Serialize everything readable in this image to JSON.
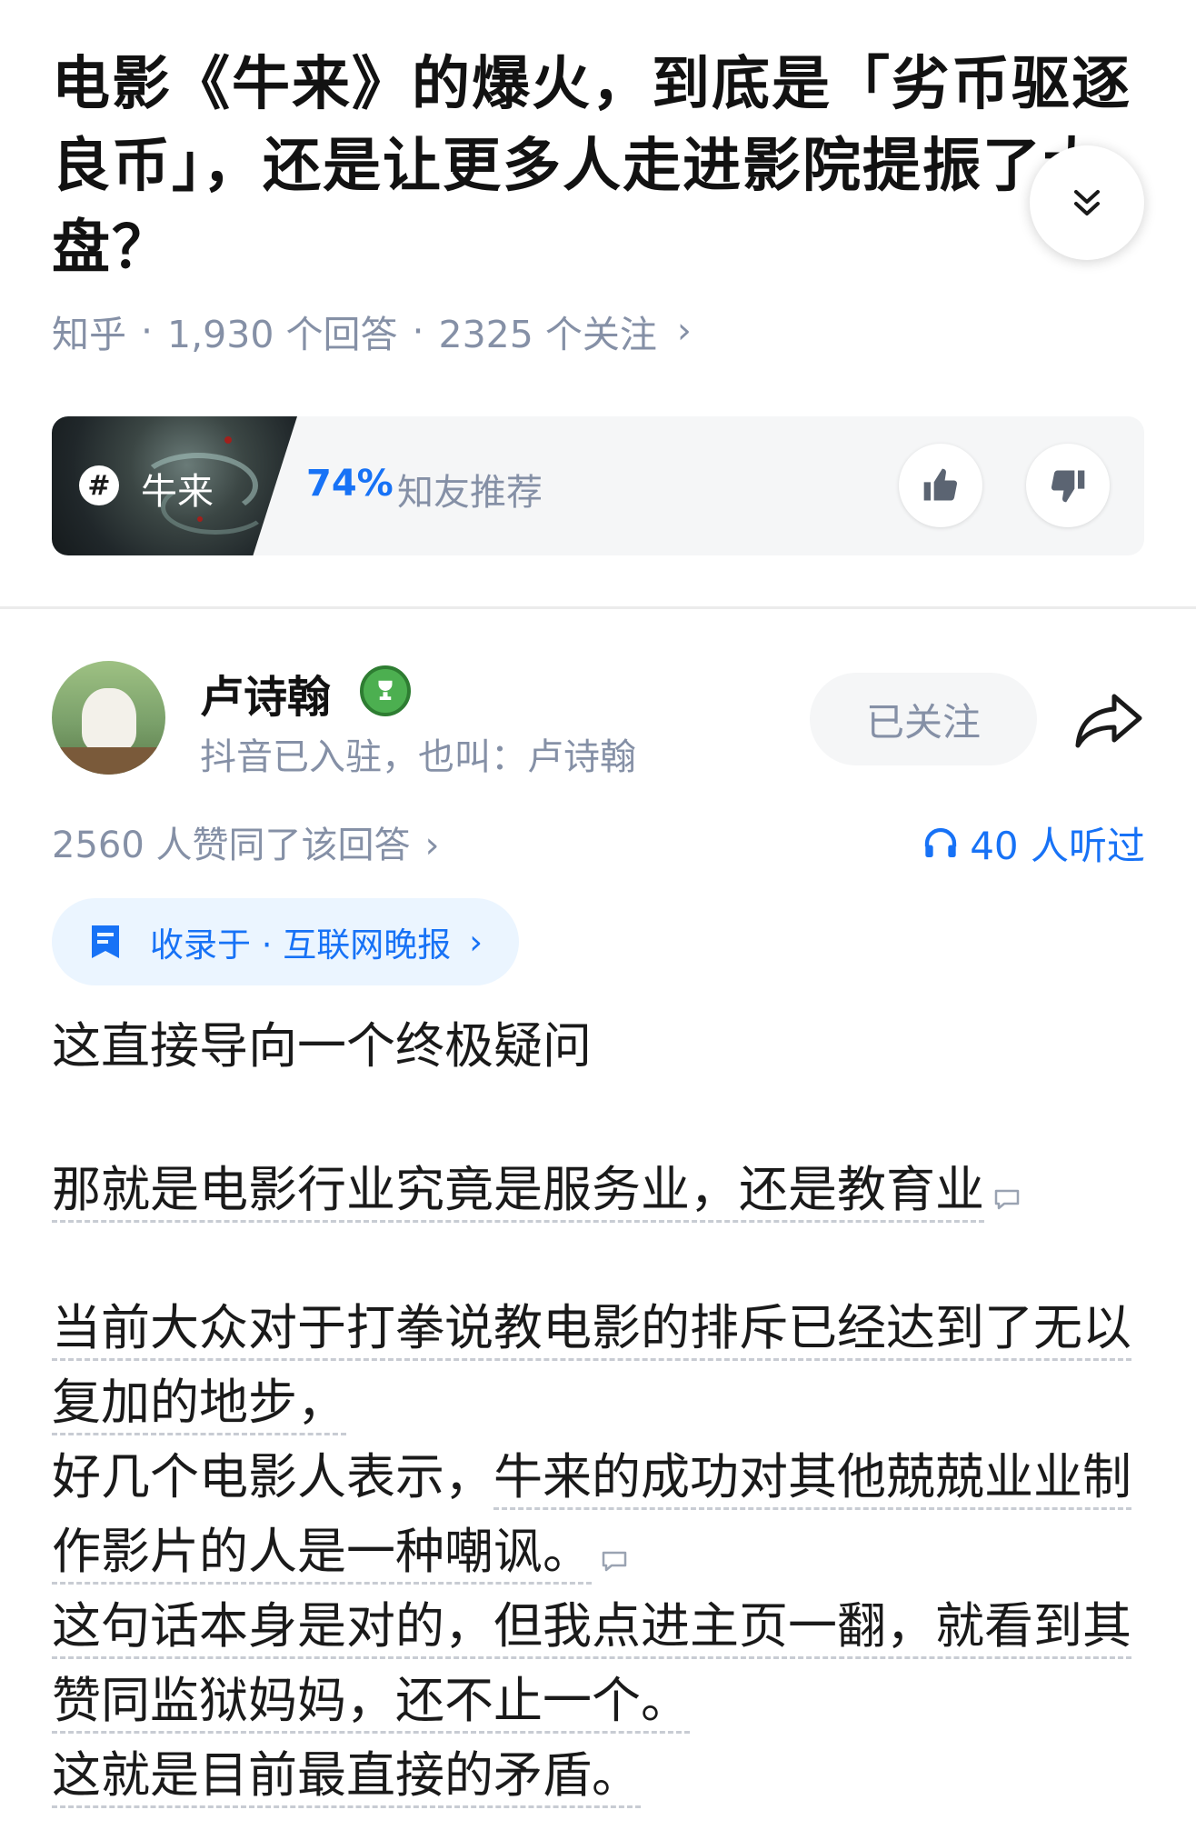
{
  "question": {
    "title": "电影《牛来》的爆火，到底是「劣币驱逐良币」，还是让更多人走进影院提振了大盘？",
    "source": "知乎",
    "answers": "1,930 个回答",
    "followers": "2325 个关注"
  },
  "topic": {
    "name": "牛来",
    "percent": "74%",
    "recommend_label": "知友推荐"
  },
  "author": {
    "name": "卢诗翰",
    "description": "抖音已入驻，也叫：卢诗翰",
    "follow_label": "已关注"
  },
  "stats": {
    "likes": "2560 人赞同了该回答",
    "listens": "40 人听过"
  },
  "collection": {
    "label": "收录于 · 互联网晚报"
  },
  "content": {
    "p1": "这直接导向一个终极疑问",
    "p2": "那就是电影行业究竟是服务业，还是教育业",
    "p3_a": "当前大众对于打拳说教电影的排斥已经达到了无以复加的地步，",
    "p3_b_plain": "好几个电影人表示，",
    "p3_b_ann": "牛来的成功对其他兢兢业业制作影片的人是一种嘲讽。",
    "p3_c": "这句话本身是对的，但我点进主页一翻，就看到其赞同监狱妈妈，还不止一个。",
    "p3_d": "这就是目前最直接的矛盾。"
  },
  "icons": {
    "collapse": "double-chevron-down-icon",
    "thumb_up": "thumb-up-icon",
    "thumb_down": "thumb-down-icon",
    "share": "share-icon",
    "headphones": "headphones-icon",
    "bookmark": "bookmark-icon",
    "comment": "comment-icon",
    "badge": "trophy-badge-icon"
  },
  "colors": {
    "accent": "#1772f6",
    "muted": "#8590a6",
    "badge": "#4caf50"
  }
}
